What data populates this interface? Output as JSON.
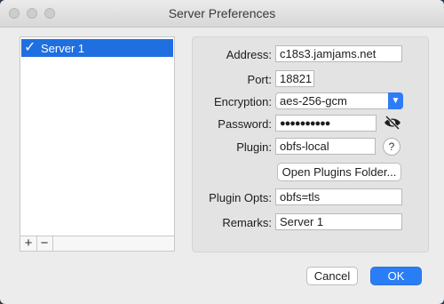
{
  "window": {
    "title": "Server Preferences"
  },
  "server_list": {
    "items": [
      {
        "label": "Server 1",
        "selected": true
      }
    ],
    "add_label": "+",
    "remove_label": "−"
  },
  "form": {
    "address": {
      "label": "Address:",
      "value": "c18s3.jamjams.net"
    },
    "port": {
      "label": "Port:",
      "value": "18821"
    },
    "encryption": {
      "label": "Encryption:",
      "value": "aes-256-gcm"
    },
    "password": {
      "label": "Password:",
      "value": "●●●●●●●●●●"
    },
    "plugin": {
      "label": "Plugin:",
      "value": "obfs-local",
      "help_label": "?"
    },
    "open_plugins_folder": "Open Plugins Folder...",
    "plugin_opts": {
      "label": "Plugin Opts:",
      "value": "obfs=tls"
    },
    "remarks": {
      "label": "Remarks:",
      "value": "Server 1"
    }
  },
  "footer": {
    "cancel_label": "Cancel",
    "ok_label": "OK"
  },
  "colors": {
    "accent": "#2a7ef5",
    "selection": "#1f6fe0"
  }
}
